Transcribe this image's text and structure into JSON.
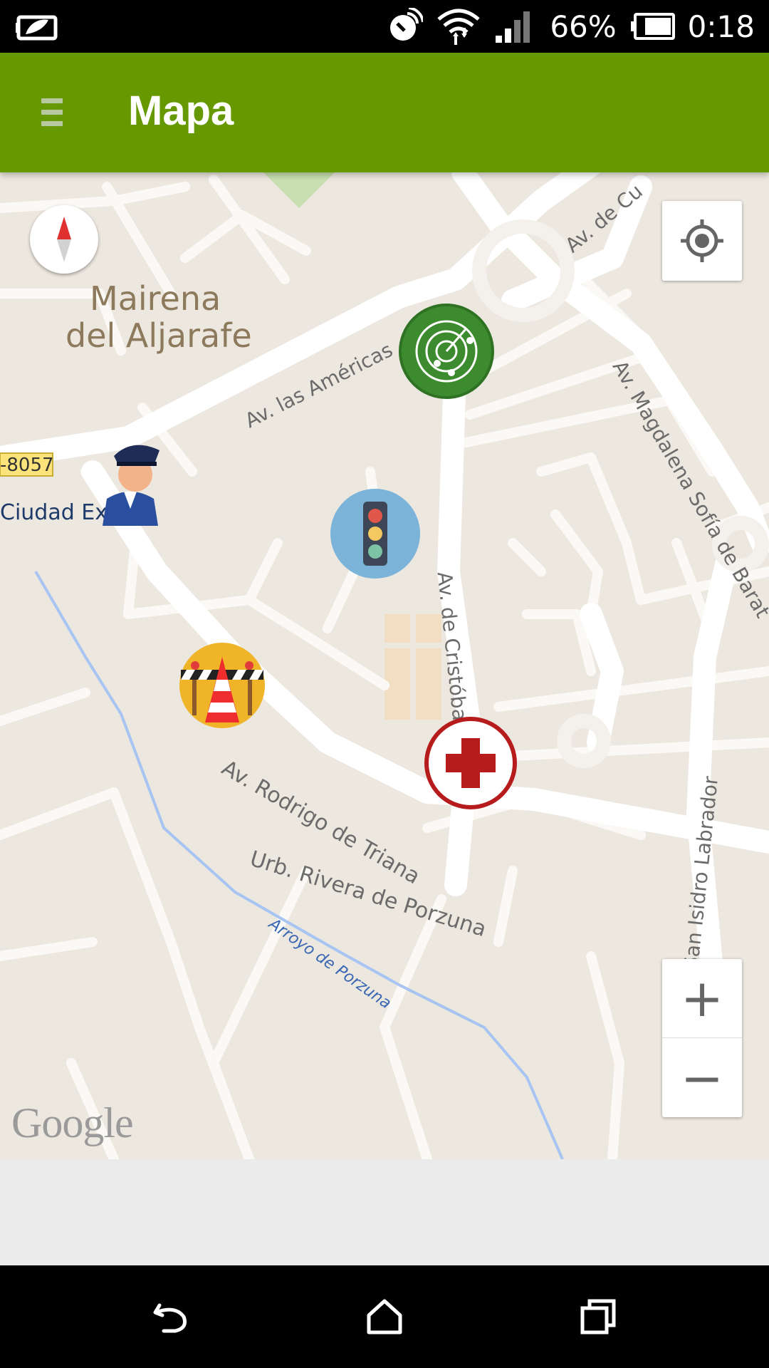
{
  "status_bar": {
    "battery_percent": "66%",
    "time": "0:18",
    "icons": [
      "battery-saver-icon",
      "nfc-icon",
      "wifi-icon",
      "cell-signal-icon",
      "battery-icon"
    ]
  },
  "app_bar": {
    "title": "Mapa",
    "menu_icon": "hamburger-menu-icon"
  },
  "map": {
    "place_labels": {
      "city_line1": "Mairena",
      "city_line2": "del Aljarafe",
      "road_badge": "-8057",
      "ciudad": "Ciudad Exp"
    },
    "street_labels": {
      "americas": "Av. las Américas",
      "cuba": "Av. de Cu",
      "magdalena": "Av. Magdalena Sofía de Barat",
      "cristobal": "Av. de Cristóbal Co",
      "rodrigo": "Av. Rodrigo de Triana",
      "porzuna_urb": "Urb. Rivera de Porzuna",
      "arroyo": "Arroyo de Porzuna",
      "isidro": "Calle San Isidro Labrador"
    },
    "markers": [
      "police-officer-icon",
      "radar-icon",
      "traffic-light-icon",
      "roadworks-cone-icon",
      "medical-cross-icon"
    ],
    "controls": {
      "zoom_in": "+",
      "zoom_out": "−"
    },
    "attribution": "Google"
  },
  "nav_bar": {
    "back_icon": "back-icon",
    "home_icon": "home-icon",
    "recents_icon": "recents-icon"
  }
}
